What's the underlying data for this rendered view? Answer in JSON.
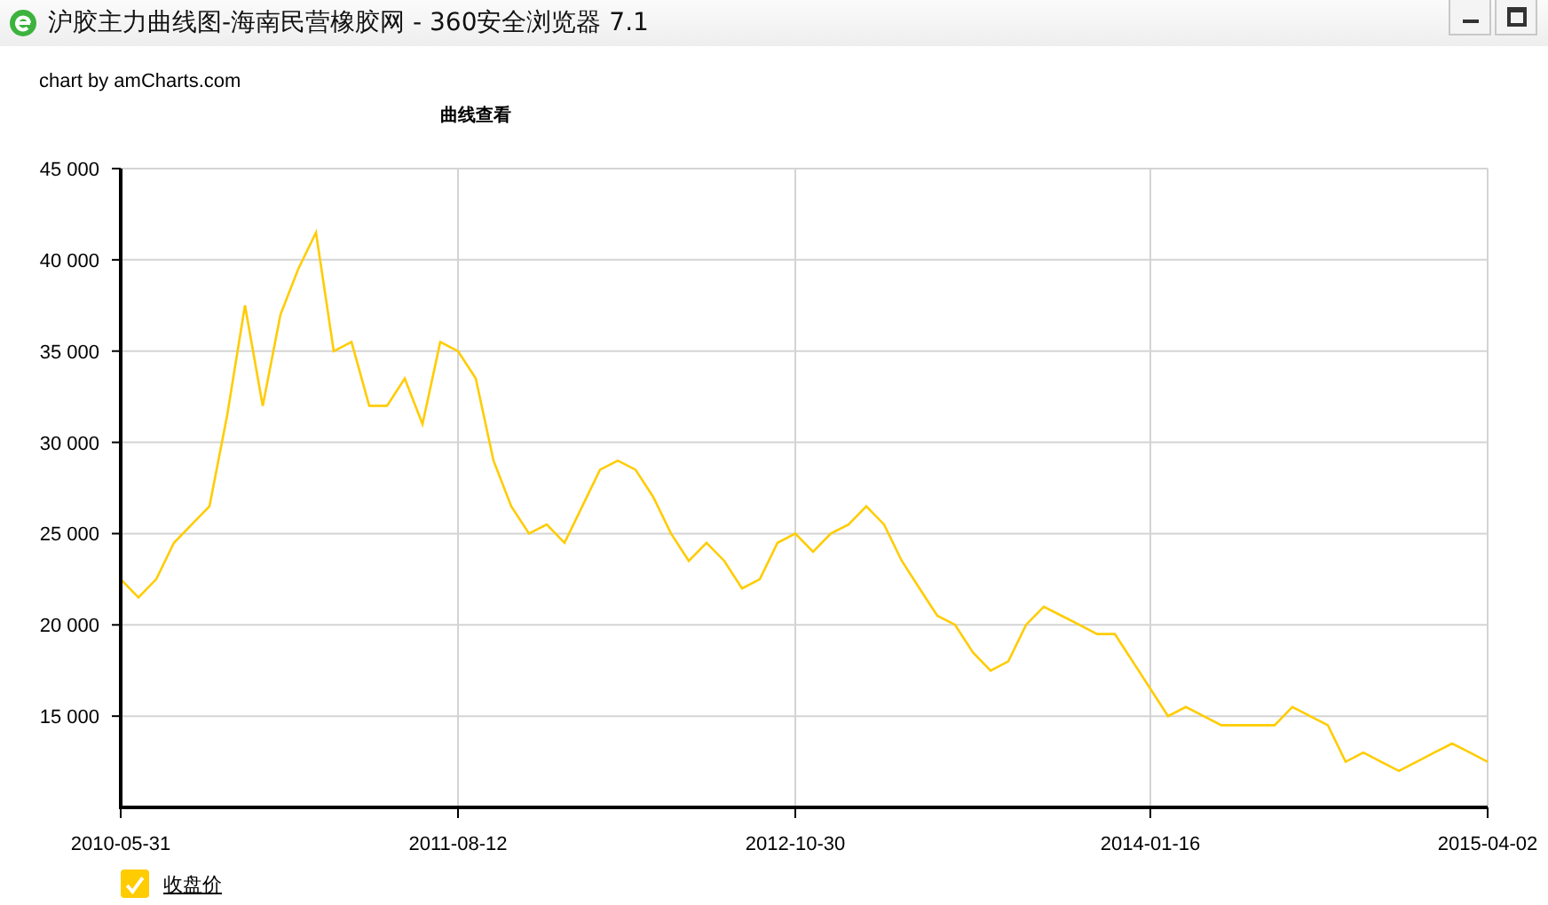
{
  "window": {
    "title": "沪胶主力曲线图-海南民营橡胶网 - 360安全浏览器 7.1"
  },
  "chart": {
    "credit": "chart by amCharts.com",
    "chart_data": {
      "type": "line",
      "title": "曲线查看",
      "grid": true,
      "ylim": [
        10000,
        45000
      ],
      "categories": [
        "2010-05-31",
        null,
        null,
        null,
        null,
        null,
        null,
        null,
        null,
        null,
        null,
        null,
        null,
        null,
        null,
        null,
        null,
        null,
        null,
        "2011-08-12",
        null,
        null,
        null,
        null,
        null,
        null,
        null,
        null,
        null,
        null,
        null,
        null,
        null,
        null,
        null,
        null,
        null,
        null,
        "2012-10-30",
        null,
        null,
        null,
        null,
        null,
        null,
        null,
        null,
        null,
        null,
        null,
        null,
        null,
        null,
        null,
        null,
        null,
        null,
        null,
        "2014-01-16",
        null,
        null,
        null,
        null,
        null,
        null,
        null,
        null,
        null,
        null,
        null,
        null,
        null,
        null,
        null,
        null,
        null,
        null,
        "2015-04-02"
      ],
      "yticks": [
        {
          "value": 15000,
          "label": "15 000"
        },
        {
          "value": 20000,
          "label": "20 000"
        },
        {
          "value": 25000,
          "label": "25 000"
        },
        {
          "value": 30000,
          "label": "30 000"
        },
        {
          "value": 35000,
          "label": "35 000"
        },
        {
          "value": 40000,
          "label": "40 000"
        },
        {
          "value": 45000,
          "label": "45 000"
        }
      ],
      "series": [
        {
          "name": "收盘价",
          "color": "#ffcc00",
          "values": [
            22500,
            21500,
            22500,
            24500,
            25500,
            26500,
            31500,
            37500,
            32000,
            37000,
            39500,
            41500,
            35000,
            35500,
            32000,
            32000,
            33500,
            31000,
            35500,
            35000,
            33500,
            29000,
            26500,
            25000,
            25500,
            24500,
            26500,
            28500,
            29000,
            28500,
            27000,
            25000,
            23500,
            24500,
            23500,
            22000,
            22500,
            24500,
            25000,
            24000,
            25000,
            25500,
            26500,
            25500,
            23500,
            22000,
            20500,
            20000,
            18500,
            17500,
            18000,
            20000,
            21000,
            20500,
            20000,
            19500,
            19500,
            18000,
            16500,
            15000,
            15500,
            15000,
            14500,
            14500,
            14500,
            14500,
            15500,
            15000,
            14500,
            12500,
            13000,
            12500,
            12000,
            12500,
            13000,
            13500,
            13000,
            12500
          ]
        }
      ]
    },
    "legend": [
      {
        "checked": true
      }
    ]
  }
}
